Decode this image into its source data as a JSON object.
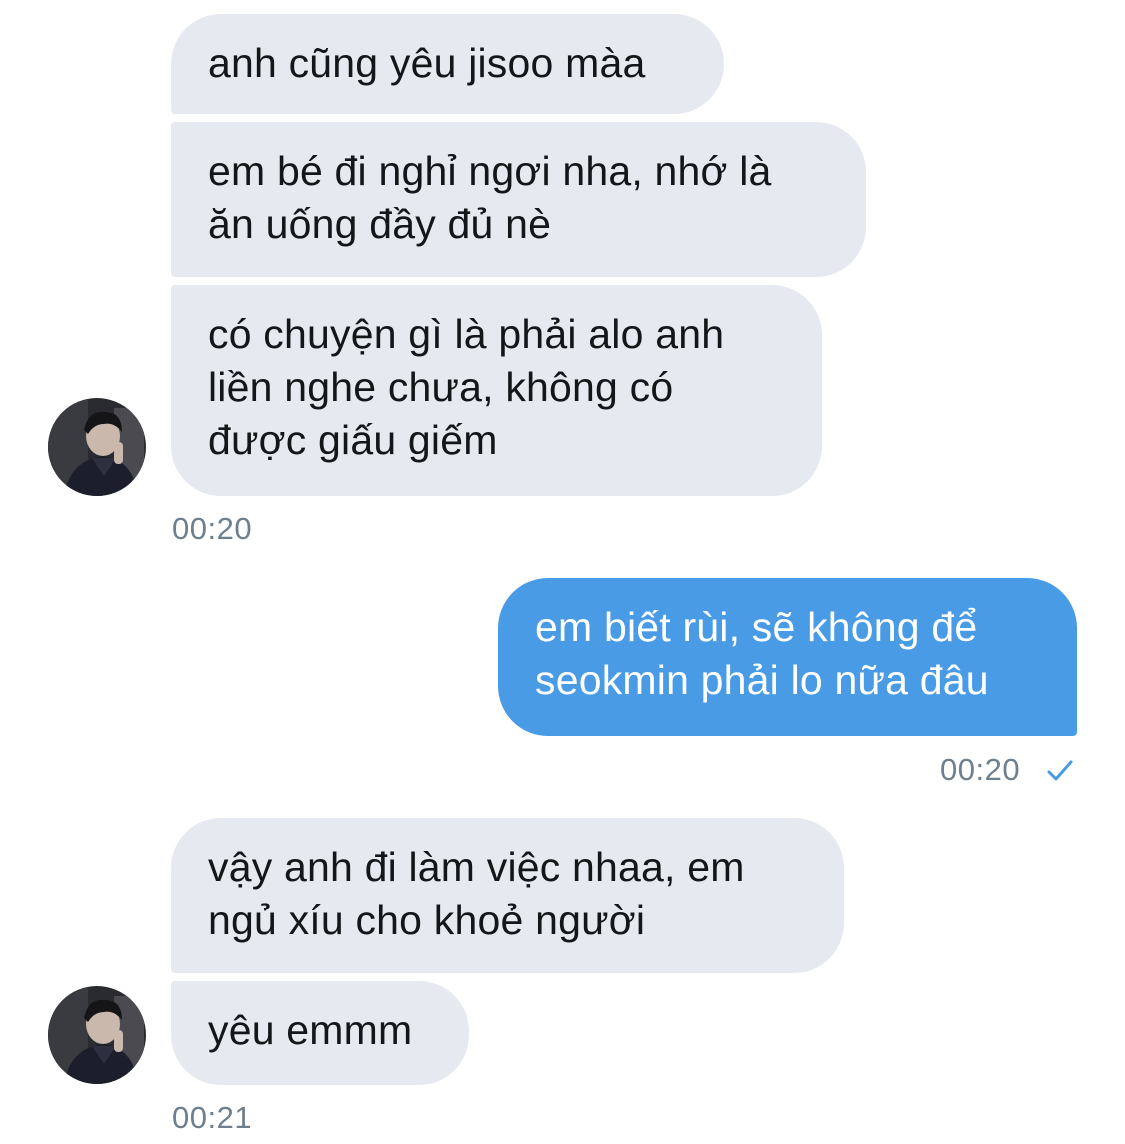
{
  "colors": {
    "incoming_bubble": "#e6e9ef",
    "outgoing_bubble": "#4a9be6",
    "timestamp": "#6e7f8d",
    "read_check": "#4a9be6"
  },
  "messages": [
    {
      "sender": "them",
      "text": "anh cũng yêu jisoo màa"
    },
    {
      "sender": "them",
      "text": "em bé đi nghỉ ngơi nha, nhớ là\năn uống đầy đủ nè"
    },
    {
      "sender": "them",
      "text": "có chuyện gì là phải alo anh\nliền nghe chưa, không có\nđược giấu giếm"
    },
    {
      "sender": "me",
      "text": "em biết rùi, sẽ không để\nseokmin phải lo nữa đâu"
    },
    {
      "sender": "them",
      "text": "vậy anh đi làm việc nhaa, em\nngủ xíu cho khoẻ người"
    },
    {
      "sender": "them",
      "text": "yêu emmm"
    }
  ],
  "timestamps": [
    "00:20",
    "00:20",
    "00:21"
  ],
  "icons": {
    "avatar": "avatar-photo",
    "sent_status": "checkmark-icon"
  }
}
